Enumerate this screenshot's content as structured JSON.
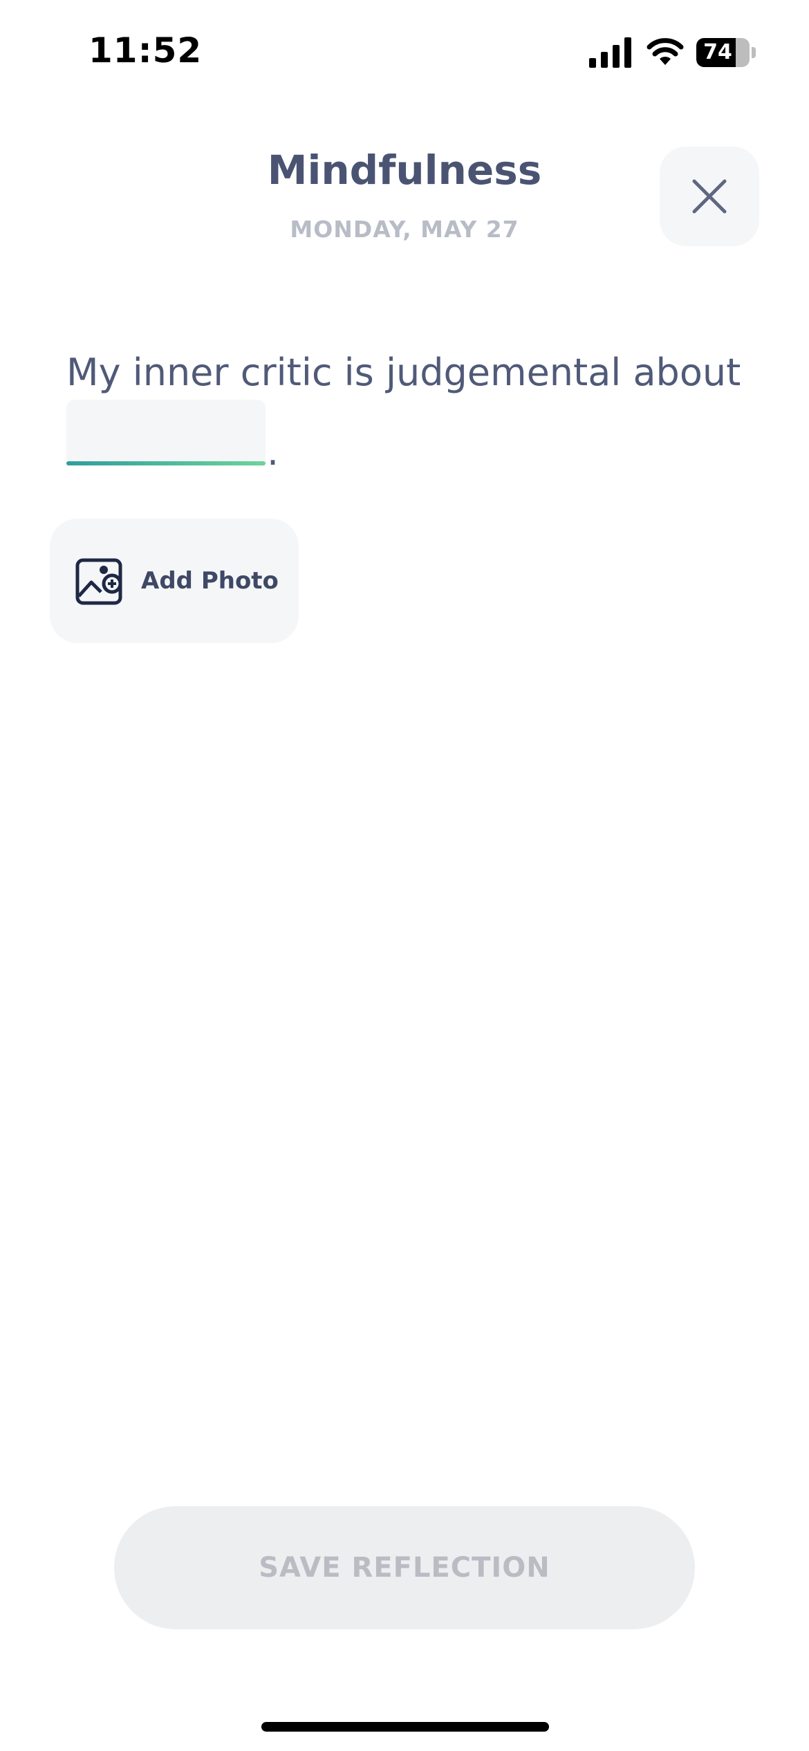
{
  "status_bar": {
    "time": "11:52",
    "battery_level": "74",
    "battery_percent": 74
  },
  "header": {
    "title": "Mindfulness",
    "date": "MONDAY, MAY 27"
  },
  "prompt": {
    "text": "My inner critic is judgemental about",
    "answer_value": "",
    "trailing": "."
  },
  "add_photo": {
    "label": "Add Photo",
    "icon": "add-photo-icon"
  },
  "save": {
    "label": "SAVE REFLECTION",
    "enabled": false
  },
  "colors": {
    "title": "#4a5472",
    "muted": "#b8bcc6",
    "accent_start": "#2f9e9c",
    "accent_end": "#6bd49a",
    "surface": "#f5f6f8"
  }
}
